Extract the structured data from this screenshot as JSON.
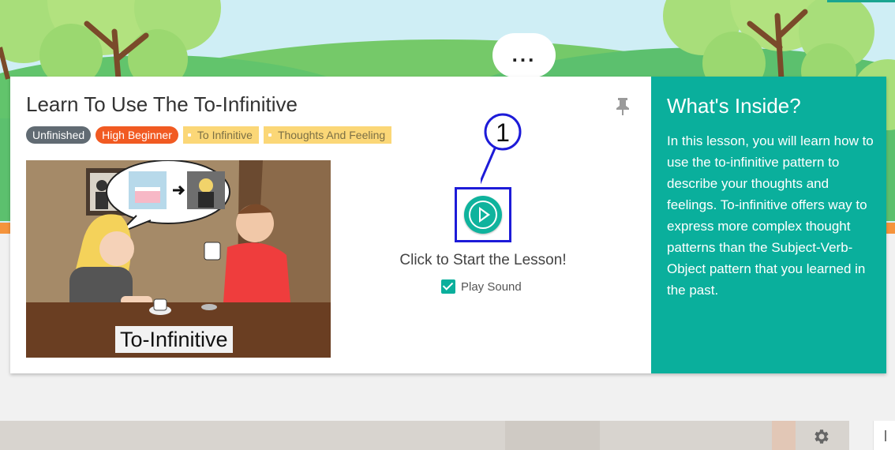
{
  "banner": {
    "bubble_text": "...",
    "colors": {
      "sky": "#cfeef5",
      "grass": "#5cc06e",
      "orange_strip": "#f5943c",
      "foliage": "#a8de7a"
    }
  },
  "lesson": {
    "title": "Learn To Use The To-Infinitive",
    "tags": [
      {
        "label": "Unfinished",
        "color": "#616b73"
      },
      {
        "label": "High Beginner",
        "color": "#f15a22"
      }
    ],
    "keywords": [
      "To Infinitive",
      "Thoughts And Feeling"
    ],
    "thumbnail_caption": "To-Infinitive",
    "annotation_number": "1",
    "start_text": "Click to Start the Lesson!",
    "play_sound": {
      "label": "Play Sound",
      "checked": true
    },
    "pin_icon": "pin-icon",
    "play_icon": "play-icon"
  },
  "inside": {
    "title": "What's Inside?",
    "description": "In this lesson, you will learn how to use the to-infinitive pattern to describe your thoughts and feelings. To-infinitive offers way to express more complex thought patterns than the Subject-Verb-Object pattern that you learned in the past.",
    "bg_color": "#0aaf9c"
  },
  "lower": {
    "gear_icon": "gear-icon"
  }
}
